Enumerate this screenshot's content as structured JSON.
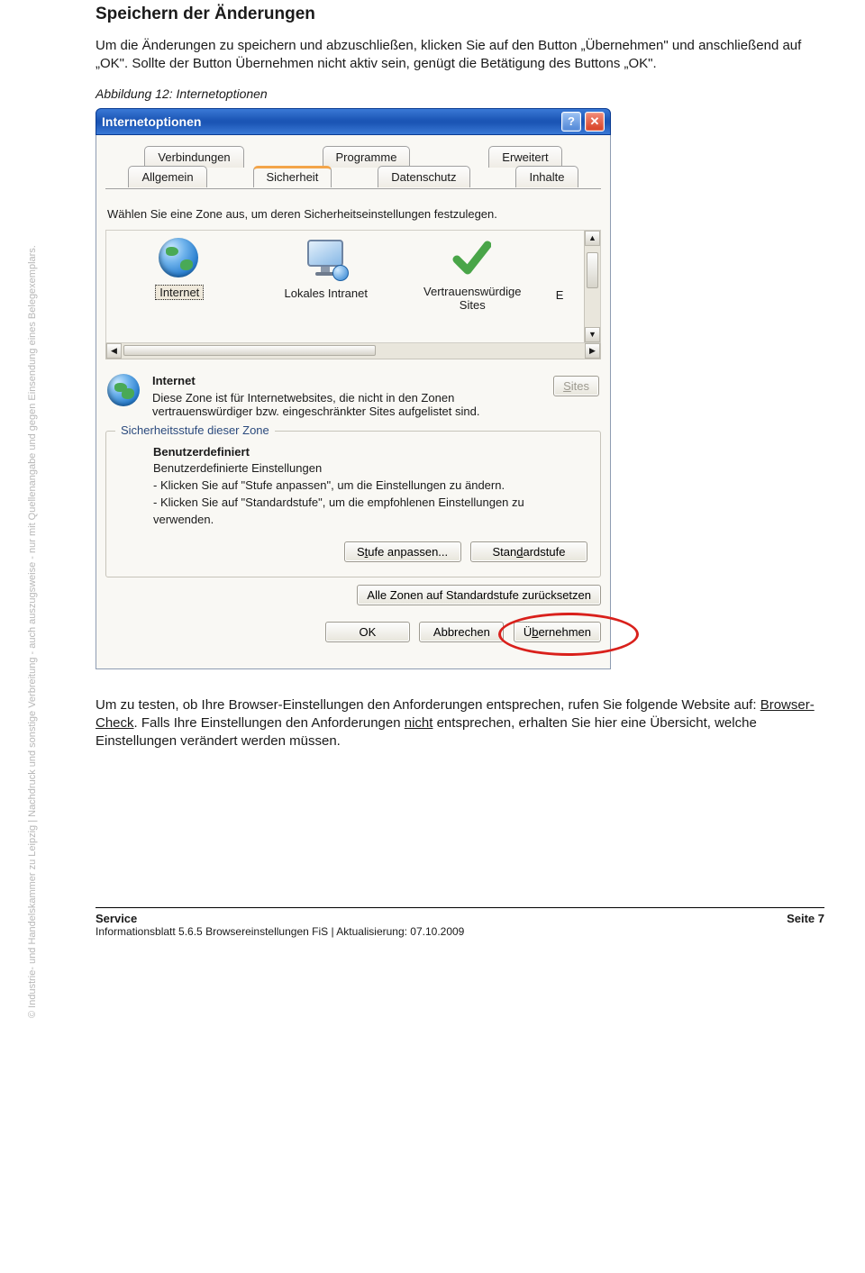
{
  "doc": {
    "title": "Speichern der Änderungen",
    "intro": "Um die Änderungen zu speichern und abzuschließen, klicken Sie auf den Button „Übernehmen\" und anschließend auf „OK\". Sollte der Button Übernehmen nicht aktiv sein, genügt die Betätigung des Buttons „OK\".",
    "caption": "Abbildung 12: Internetoptionen",
    "test_pre": "Um zu testen, ob Ihre Browser-Einstellungen den Anforderungen entsprechen, rufen Sie folgende Website auf: ",
    "test_link": "Browser-Check",
    "test_mid": ". Falls Ihre Einstellungen den Anforderungen ",
    "test_not": "nicht",
    "test_post": " entsprechen, erhalten Sie hier eine Übersicht, welche Einstellungen verändert werden müssen.",
    "side": "© Industrie- und Handelskammer zu Leipzig | Nachdruck und sonstige Verbreitung - auch auszugsweise - nur mit Quellenangabe und gegen Einsendung eines Belegexemplars."
  },
  "dialog": {
    "title": "Internetoptionen",
    "tabs_back": [
      "Verbindungen",
      "Programme",
      "Erweitert"
    ],
    "tabs_front": [
      "Allgemein",
      "Sicherheit",
      "Datenschutz",
      "Inhalte"
    ],
    "instr": "Wählen Sie eine Zone aus, um deren Sicherheitseinstellungen festzulegen.",
    "zones": {
      "internet": "Internet",
      "intranet": "Lokales Intranet",
      "trusted": "Vertrauenswürdige Sites",
      "cut": "E"
    },
    "zone_desc": {
      "hdr": "Internet",
      "body": "Diese Zone ist für Internetwebsites, die nicht in den Zonen vertrauenswürdiger bzw. eingeschränkter Sites aufgelistet sind.",
      "sites": "Sites"
    },
    "group": {
      "legend": "Sicherheitsstufe dieser Zone",
      "hdr": "Benutzerdefiniert",
      "l1": "Benutzerdefinierte Einstellungen",
      "l2": "- Klicken Sie auf \"Stufe anpassen\", um die Einstellungen zu ändern.",
      "l3": "- Klicken Sie auf \"Standardstufe\", um die empfohlenen Einstellungen zu verwenden.",
      "btn_level": "Stufe anpassen...",
      "btn_std": "Standardstufe"
    },
    "reset": "Alle Zonen auf Standardstufe zurücksetzen",
    "ok": "OK",
    "cancel": "Abbrechen",
    "apply": "Übernehmen"
  },
  "footer": {
    "service": "Service",
    "line": "Informationsblatt 5.6.5 Browsereinstellungen FiS | Aktualisierung: 07.10.2009",
    "page": "Seite 7"
  }
}
